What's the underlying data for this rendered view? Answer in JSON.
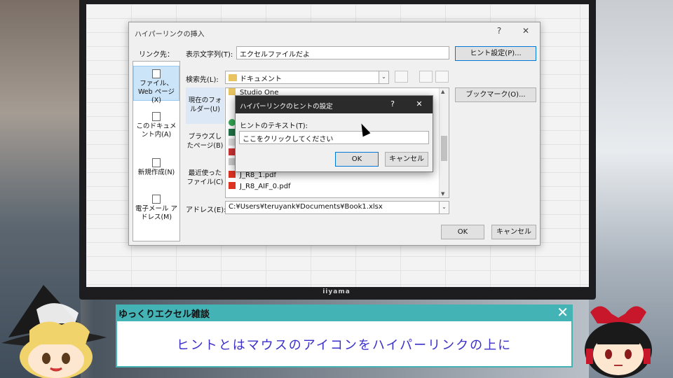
{
  "monitor_brand": "iiyama",
  "dialog": {
    "title": "ハイパーリンクの挿入",
    "help": "?",
    "close": "✕",
    "link_to_label": "リンク先：",
    "display_text_label": "表示文字列(T):",
    "display_text_value": "エクセルファイルだよ",
    "screentip_button": "ヒント設定(P)...",
    "look_in_label": "検索先(L):",
    "look_in_value": "ドキュメント",
    "bookmark_button": "ブックマーク(O)...",
    "address_label": "アドレス(E):",
    "address_value": "C:¥Users¥teruyank¥Documents¥Book1.xlsx",
    "ok": "OK",
    "cancel": "キャンセル",
    "link_items": [
      {
        "label": "ファイル、Web ページ(X)"
      },
      {
        "label": "このドキュメント内(A)"
      },
      {
        "label": "新規作成(N)"
      },
      {
        "label": "電子メール アドレス(M)"
      }
    ],
    "nav_items": [
      {
        "label": "現在のフォルダー(U)"
      },
      {
        "label": "ブラウズしたページ(B)"
      },
      {
        "label": "最近使ったファイル(C)"
      }
    ],
    "files": [
      {
        "name": "Studio One"
      },
      {
        "name": "J_R8_1.pdf"
      },
      {
        "name": "J_R8_AIF_0.pdf"
      }
    ]
  },
  "hint_dialog": {
    "title": "ハイパーリンクのヒントの設定",
    "help": "?",
    "close": "✕",
    "text_label": "ヒントのテキスト(T):",
    "text_value": "ここをクリックしてください",
    "ok": "OK",
    "cancel": "キャンセル"
  },
  "caption": {
    "title": "ゆっくりエクセル雑談",
    "close": "✕",
    "text": "ヒントとはマウスのアイコンをハイパーリンクの上に"
  },
  "colors": {
    "caption_accent": "#44b3b6",
    "caption_text": "#3b2fc9"
  }
}
